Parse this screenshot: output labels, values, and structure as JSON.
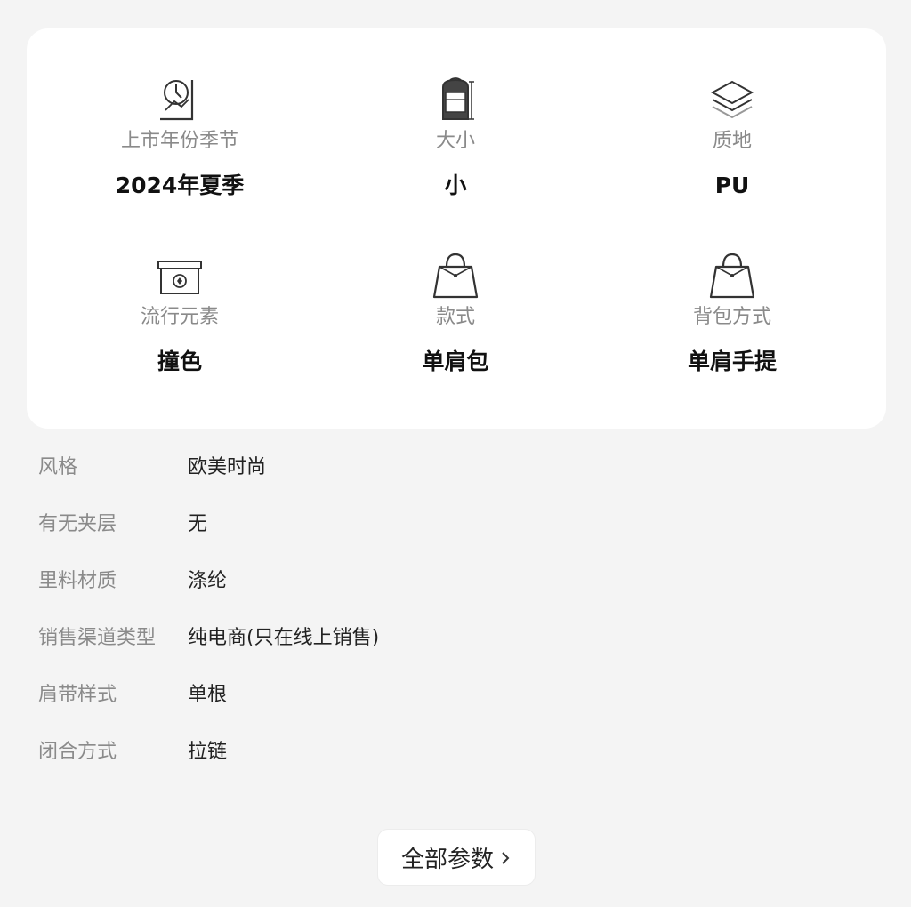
{
  "attributes": [
    {
      "icon": "calendar-season-icon",
      "label": "上市年份季节",
      "value": "2024年夏季"
    },
    {
      "icon": "backpack-size-icon",
      "label": "大小",
      "value": "小"
    },
    {
      "icon": "layers-icon",
      "label": "质地",
      "value": "PU"
    },
    {
      "icon": "trend-box-icon",
      "label": "流行元素",
      "value": "撞色"
    },
    {
      "icon": "handbag-icon",
      "label": "款式",
      "value": "单肩包"
    },
    {
      "icon": "handbag-icon",
      "label": "背包方式",
      "value": "单肩手提"
    }
  ],
  "params": [
    {
      "key": "风格",
      "value": "欧美时尚"
    },
    {
      "key": "有无夹层",
      "value": "无"
    },
    {
      "key": "里料材质",
      "value": "涤纶"
    },
    {
      "key": "销售渠道类型",
      "value": "纯电商(只在线上销售)"
    },
    {
      "key": "肩带样式",
      "value": "单根"
    },
    {
      "key": "闭合方式",
      "value": "拉链"
    }
  ],
  "all_params_button": {
    "label": "全部参数",
    "icon": "chevron-right-icon"
  }
}
